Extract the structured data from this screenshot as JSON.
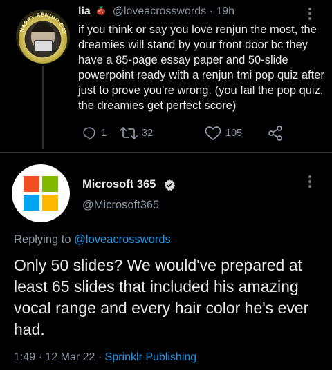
{
  "quoted_tweet": {
    "display_name": "lia",
    "handle": "@loveacrosswords",
    "separator": "·",
    "time": "19h",
    "text": "if you think or say you love renjun the most, the dreamies will stand by your front door bc they have a 85-page essay paper and 50-slide powerpoint ready with a renjun tmi pop quiz after just to prove you're wrong. (you fail the pop quiz, the dreamies get perfect score)",
    "avatar_ring_text": "HAPPY RENJUN DAY",
    "actions": {
      "reply_count": "1",
      "retweet_count": "32",
      "like_count": "105"
    },
    "icons": [
      "reply-icon",
      "retweet-icon",
      "like-icon",
      "share-icon",
      "more-icon"
    ]
  },
  "main_tweet": {
    "display_name": "Microsoft 365",
    "handle": "@Microsoft365",
    "replying_to_prefix": "Replying to",
    "replying_to_handle": "@loveacrosswords",
    "text": "Only 50 slides? We would've prepared at least 65 slides that included his amazing vocal range and every hair color he's ever had.",
    "time": "1:49",
    "separator": "·",
    "date": "12 Mar 22",
    "source": "Sprinklr Publishing",
    "logo_colors": [
      "#f25022",
      "#7fba00",
      "#00a4ef",
      "#ffb900"
    ]
  },
  "colors": {
    "background": "#000000",
    "text": "#e7e9ea",
    "muted": "#8b98a5",
    "link": "#1d9bf0",
    "divider": "#2f3336"
  }
}
